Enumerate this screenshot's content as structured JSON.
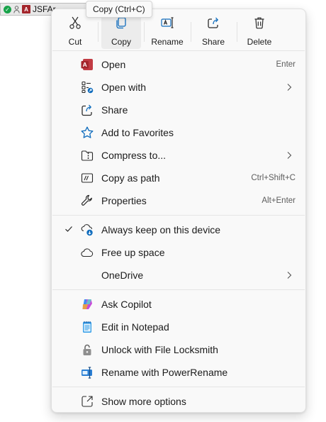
{
  "background_file": {
    "name_fragment": "JSFAr..."
  },
  "tooltip": {
    "text": "Copy (Ctrl+C)"
  },
  "quick_actions": [
    {
      "label": "Cut",
      "icon": "scissors-icon"
    },
    {
      "label": "Copy",
      "icon": "copy-icon",
      "active": true
    },
    {
      "label": "Rename",
      "icon": "rename-icon"
    },
    {
      "label": "Share",
      "icon": "share-icon"
    },
    {
      "label": "Delete",
      "icon": "trash-icon"
    }
  ],
  "group1": [
    {
      "label": "Open",
      "shortcut": "Enter",
      "icon": "access-app-icon"
    },
    {
      "label": "Open with",
      "submenu": true,
      "icon": "open-with-icon"
    },
    {
      "label": "Share",
      "icon": "share-icon"
    },
    {
      "label": "Add to Favorites",
      "icon": "star-icon"
    },
    {
      "label": "Compress to...",
      "submenu": true,
      "icon": "zip-folder-icon"
    },
    {
      "label": "Copy as path",
      "shortcut": "Ctrl+Shift+C",
      "icon": "copy-path-icon"
    },
    {
      "label": "Properties",
      "shortcut": "Alt+Enter",
      "icon": "wrench-icon"
    }
  ],
  "group2": [
    {
      "label": "Always keep on this device",
      "checked": true,
      "icon": "cloud-sync-icon"
    },
    {
      "label": "Free up space",
      "icon": "cloud-icon"
    },
    {
      "label": "OneDrive",
      "submenu": true
    }
  ],
  "group3": [
    {
      "label": "Ask Copilot",
      "icon": "copilot-icon"
    },
    {
      "label": "Edit in Notepad",
      "icon": "notepad-icon"
    },
    {
      "label": "Unlock with File Locksmith",
      "icon": "lock-icon"
    },
    {
      "label": "Rename with PowerRename",
      "icon": "power-rename-icon"
    }
  ],
  "group4": [
    {
      "label": "Show more options",
      "icon": "more-options-icon"
    }
  ],
  "colors": {
    "accent": "#0f6cbd",
    "access_red": "#a4262c",
    "menu_bg": "#f9f9f9"
  }
}
